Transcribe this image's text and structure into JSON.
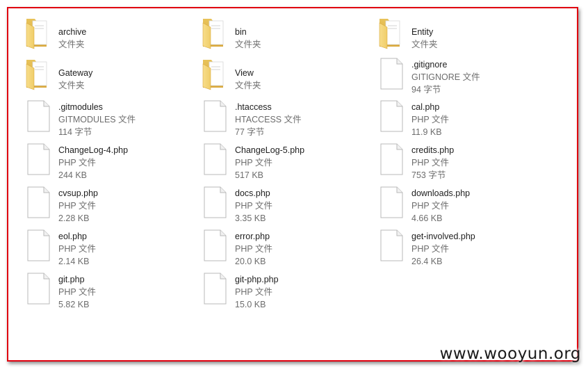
{
  "items": [
    {
      "kind": "folder",
      "name": "archive",
      "type": "文件夹",
      "size": ""
    },
    {
      "kind": "folder",
      "name": "bin",
      "type": "文件夹",
      "size": ""
    },
    {
      "kind": "folder",
      "name": "Entity",
      "type": "文件夹",
      "size": ""
    },
    {
      "kind": "folder",
      "name": "Gateway",
      "type": "文件夹",
      "size": ""
    },
    {
      "kind": "folder",
      "name": "View",
      "type": "文件夹",
      "size": ""
    },
    {
      "kind": "file",
      "name": ".gitignore",
      "type": "GITIGNORE 文件",
      "size": "94 字节"
    },
    {
      "kind": "file",
      "name": ".gitmodules",
      "type": "GITMODULES 文件",
      "size": "114 字节"
    },
    {
      "kind": "file",
      "name": ".htaccess",
      "type": "HTACCESS 文件",
      "size": "77 字节"
    },
    {
      "kind": "file",
      "name": "cal.php",
      "type": "PHP 文件",
      "size": "11.9 KB"
    },
    {
      "kind": "file",
      "name": "ChangeLog-4.php",
      "type": "PHP 文件",
      "size": "244 KB"
    },
    {
      "kind": "file",
      "name": "ChangeLog-5.php",
      "type": "PHP 文件",
      "size": "517 KB"
    },
    {
      "kind": "file",
      "name": "credits.php",
      "type": "PHP 文件",
      "size": "753 字节"
    },
    {
      "kind": "file",
      "name": "cvsup.php",
      "type": "PHP 文件",
      "size": "2.28 KB"
    },
    {
      "kind": "file",
      "name": "docs.php",
      "type": "PHP 文件",
      "size": "3.35 KB"
    },
    {
      "kind": "file",
      "name": "downloads.php",
      "type": "PHP 文件",
      "size": "4.66 KB"
    },
    {
      "kind": "file",
      "name": "eol.php",
      "type": "PHP 文件",
      "size": "2.14 KB"
    },
    {
      "kind": "file",
      "name": "error.php",
      "type": "PHP 文件",
      "size": "20.0 KB"
    },
    {
      "kind": "file",
      "name": "get-involved.php",
      "type": "PHP 文件",
      "size": "26.4 KB"
    },
    {
      "kind": "file",
      "name": "git.php",
      "type": "PHP 文件",
      "size": "5.82 KB"
    },
    {
      "kind": "file",
      "name": "git-php.php",
      "type": "PHP 文件",
      "size": "15.0 KB"
    }
  ],
  "watermark": "www.wooyun.org",
  "colors": {
    "border": "#e0000f",
    "folder": "#f0cf6a",
    "text": "#1e1e1e",
    "subtext": "#6d6d6d"
  }
}
